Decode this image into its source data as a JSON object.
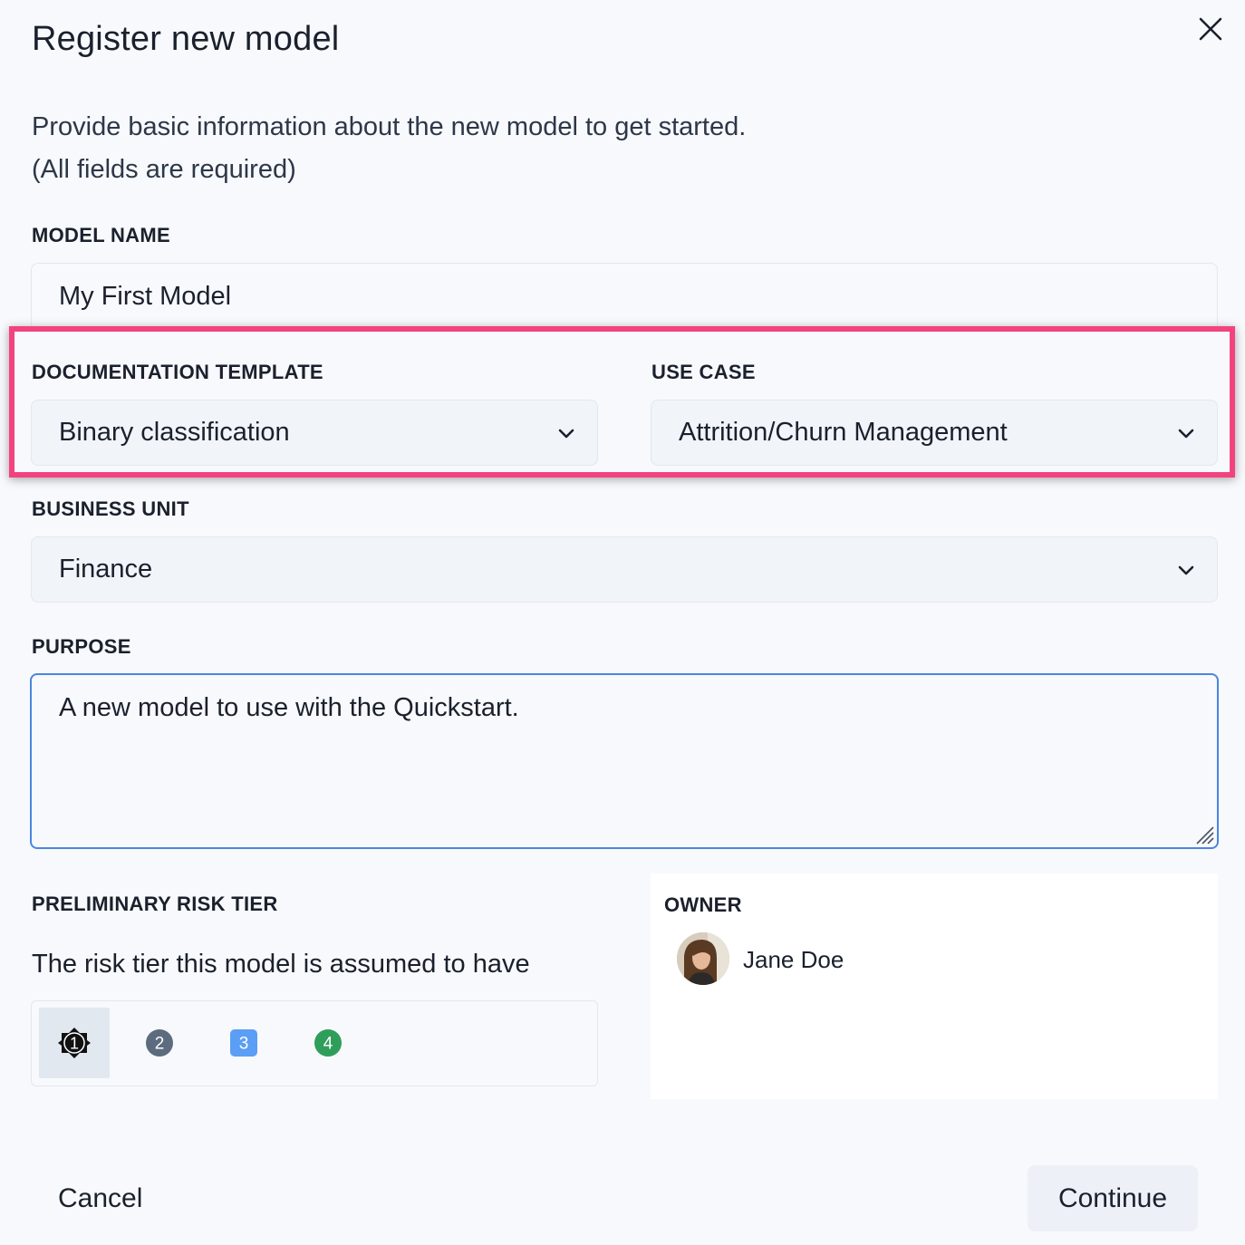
{
  "dialog": {
    "title": "Register new model",
    "intro_line1": "Provide basic information about the new model to get started.",
    "intro_line2": "(All fields are required)"
  },
  "model_name": {
    "label": "MODEL NAME",
    "value": "My First Model"
  },
  "documentation_template": {
    "label": "DOCUMENTATION TEMPLATE",
    "value": "Binary classification"
  },
  "use_case": {
    "label": "USE CASE",
    "value": "Attrition/Churn Management"
  },
  "business_unit": {
    "label": "BUSINESS UNIT",
    "value": "Finance"
  },
  "purpose": {
    "label": "PURPOSE",
    "value": "A new model to use with the Quickstart."
  },
  "risk_tier": {
    "label": "PRELIMINARY RISK TIER",
    "description": "The risk tier this model is assumed to have",
    "options": [
      "1",
      "2",
      "3",
      "4"
    ],
    "selected": "1",
    "colors": {
      "1": "#111111",
      "2": "#5d6b7e",
      "3": "#5b9ef5",
      "4": "#2f9e5b"
    }
  },
  "owner": {
    "label": "OWNER",
    "name": "Jane Doe"
  },
  "footer": {
    "cancel_label": "Cancel",
    "continue_label": "Continue"
  },
  "colors": {
    "highlight": "#f3437f",
    "focus": "#4a86e0"
  }
}
